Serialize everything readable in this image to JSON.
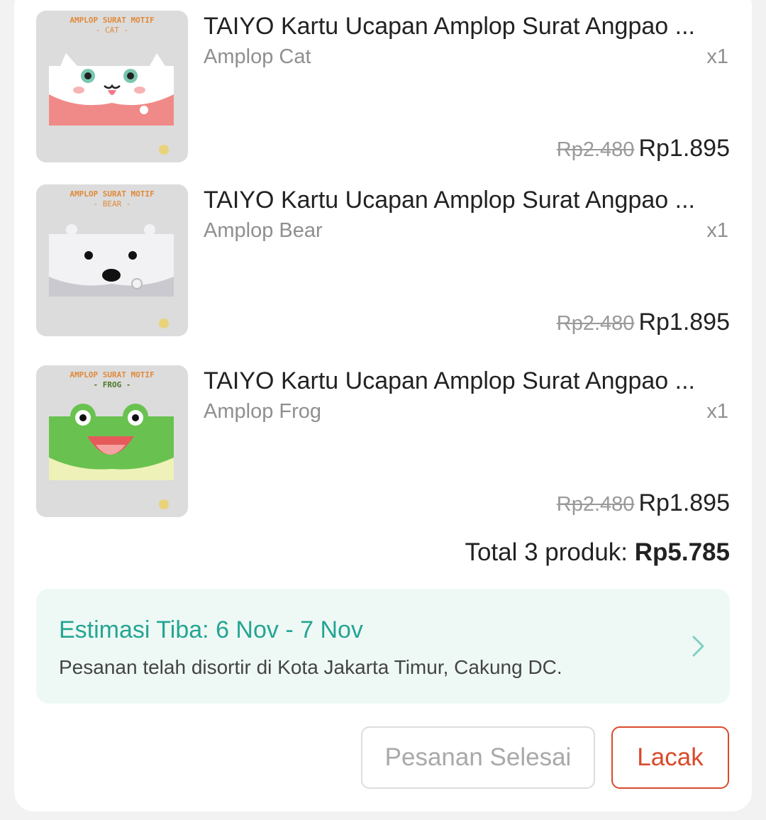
{
  "items": [
    {
      "title": "TAIYO Kartu Ucapan Amplop Surat Angpao ...",
      "variant": "Amplop Cat",
      "quantity": "x1",
      "original_price": "Rp2.480",
      "price": "Rp1.895",
      "image": {
        "heading": "AMPLOP SURAT MOTIF",
        "subheading": "- CAT -",
        "icon": "cat-envelope-icon"
      }
    },
    {
      "title": "TAIYO Kartu Ucapan Amplop Surat Angpao ...",
      "variant": "Amplop Bear",
      "quantity": "x1",
      "original_price": "Rp2.480",
      "price": "Rp1.895",
      "image": {
        "heading": "AMPLOP SURAT MOTIF",
        "subheading": "- BEAR -",
        "icon": "bear-envelope-icon"
      }
    },
    {
      "title": "TAIYO Kartu Ucapan Amplop Surat Angpao ...",
      "variant": "Amplop Frog",
      "quantity": "x1",
      "original_price": "Rp2.480",
      "price": "Rp1.895",
      "image": {
        "heading": "AMPLOP SURAT MOTIF",
        "subheading": "- FROG -",
        "icon": "frog-envelope-icon"
      }
    }
  ],
  "summary": {
    "total_label": "Total 3 produk: ",
    "total_value": "Rp5.785"
  },
  "delivery": {
    "estimate": "Estimasi Tiba: 6 Nov - 7 Nov",
    "status": "Pesanan telah disortir di Kota Jakarta Timur, Cakung DC.",
    "icon": "chevron-right-icon"
  },
  "actions": {
    "completed_label": "Pesanan Selesai",
    "track_label": "Lacak"
  },
  "colors": {
    "accent_green": "#26a592",
    "accent_orange": "#d94a2b",
    "delivery_bg": "#eef9f6",
    "thumb_label": "#e08a3a"
  }
}
